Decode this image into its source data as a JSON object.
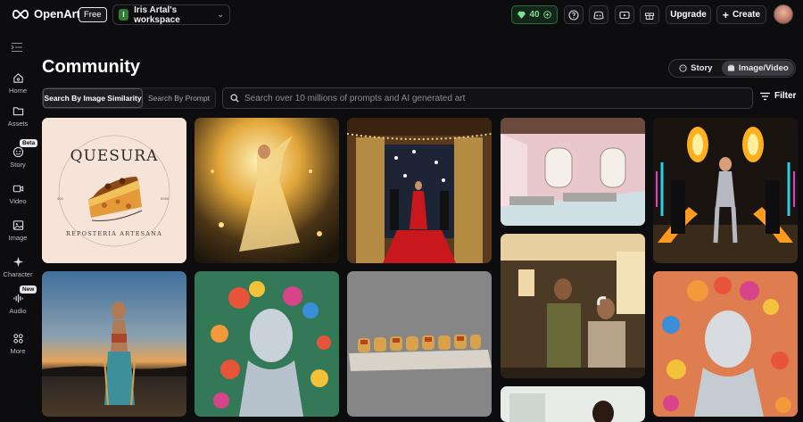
{
  "brand": {
    "name": "OpenArt",
    "plan_badge": "Free"
  },
  "workspace": {
    "initial": "I",
    "name": "Iris Artal's workspace"
  },
  "credits": {
    "count": "40"
  },
  "topbar": {
    "upgrade_label": "Upgrade",
    "create_label": "Create"
  },
  "sidebar": {
    "items": [
      {
        "label": "Home",
        "icon": "home-icon"
      },
      {
        "label": "Assets",
        "icon": "folder-icon"
      },
      {
        "label": "Story",
        "icon": "story-icon",
        "badge": "Beta"
      },
      {
        "label": "Video",
        "icon": "video-icon"
      },
      {
        "label": "Image",
        "icon": "image-icon"
      },
      {
        "label": "Character",
        "icon": "character-icon"
      },
      {
        "label": "Audio",
        "icon": "audio-icon",
        "badge": "New"
      },
      {
        "label": "More",
        "icon": "more-icon"
      }
    ]
  },
  "main": {
    "title": "Community",
    "mode_toggle": {
      "story_label": "Story",
      "image_video_label": "Image/Video",
      "active": "Image/Video"
    },
    "search_tabs": {
      "similarity_label": "Search By Image Similarity",
      "prompt_label": "Search By Prompt",
      "active": "similarity"
    },
    "search": {
      "placeholder": "Search over 10 millions of prompts and AI generated art"
    },
    "filter_label": "Filter",
    "gallery": {
      "logo_card": {
        "title": "QUESURA",
        "subtitle": "REPOSTERIA ARTESANA",
        "year_left": "300",
        "year_right": "2020"
      },
      "colors": {
        "accent_green": "#7fe08e",
        "dress_red": "#c8181e",
        "cake_orange": "#e08a2c"
      }
    }
  }
}
